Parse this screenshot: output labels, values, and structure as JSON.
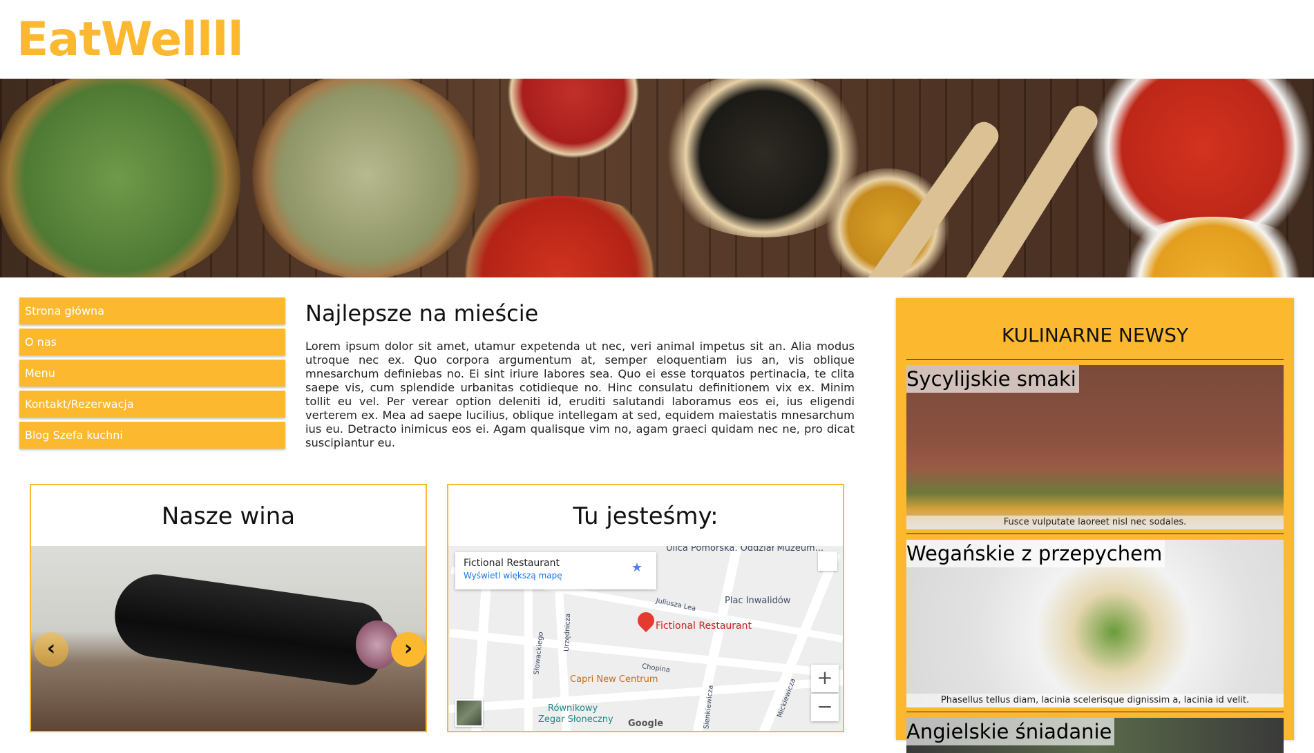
{
  "brand": {
    "logo": "EatWellll",
    "accent": "#fcb930"
  },
  "nav": {
    "items": [
      {
        "label": "Strona główna"
      },
      {
        "label": "O nas"
      },
      {
        "label": "Menu"
      },
      {
        "label": "Kontakt/Rezerwacja"
      },
      {
        "label": "Blog Szefa kuchni"
      }
    ]
  },
  "article": {
    "title": "Najlepsze na mieście",
    "body": "Lorem ipsum dolor sit amet, utamur expetenda ut nec, veri animal impetus sit an. Alia modus utroque nec ex. Quo corpora argumentum at, semper eloquentiam ius an, vis oblique mnesarchum definiebas no. Ei sint iriure labores sea. Quo ei esse torquatos pertinacia, te clita saepe vis, cum splendide urbanitas cotidieque no. Hinc consulatu definitionem vix ex. Minim tollit eu vel. Per verear option deleniti id, eruditi salutandi laboramus eos ei, ius eligendi verterem ex. Mea ad saepe lucilius, oblique intellegam at sed, equidem maiestatis mnesarchum ius eu. Detracto inimicus eos ei. Agam qualisque vim no, agam graeci quidam nec ne, pro dicat suscipiantur eu."
  },
  "wines": {
    "title": "Nasze wina",
    "prev_icon": "chevron-left-icon",
    "next_icon": "chevron-right-icon"
  },
  "location": {
    "title": "Tu jesteśmy:",
    "map": {
      "place_name": "Fictional Restaurant",
      "larger_map_link": "Wyświetl większą mapę",
      "pin_label": "Fictional Restaurant",
      "labels": [
        "Ulica Pomorska. Oddział Muzeum...",
        "Plac Inwalidów",
        "Juliusza Lea",
        "Capri New Centrum",
        "Chopina",
        "Równikowy",
        "Zegar Słoneczny",
        "Urzędnicza",
        "Sienkiewicza",
        "Mickiewicza",
        "Słowackiego"
      ],
      "zoom_in": "+",
      "zoom_out": "−",
      "attribution": "Google"
    }
  },
  "news": {
    "title": "KULINARNE NEWSY",
    "items": [
      {
        "title": "Sycylijskie smaki",
        "caption": "Fusce vulputate laoreet nisl nec sodales."
      },
      {
        "title": "Wegańskie z przepychem",
        "caption": "Phasellus tellus diam, lacinia scelerisque dignissim a, lacinia id velit."
      },
      {
        "title": "Angielskie śniadanie",
        "caption": ""
      }
    ]
  }
}
